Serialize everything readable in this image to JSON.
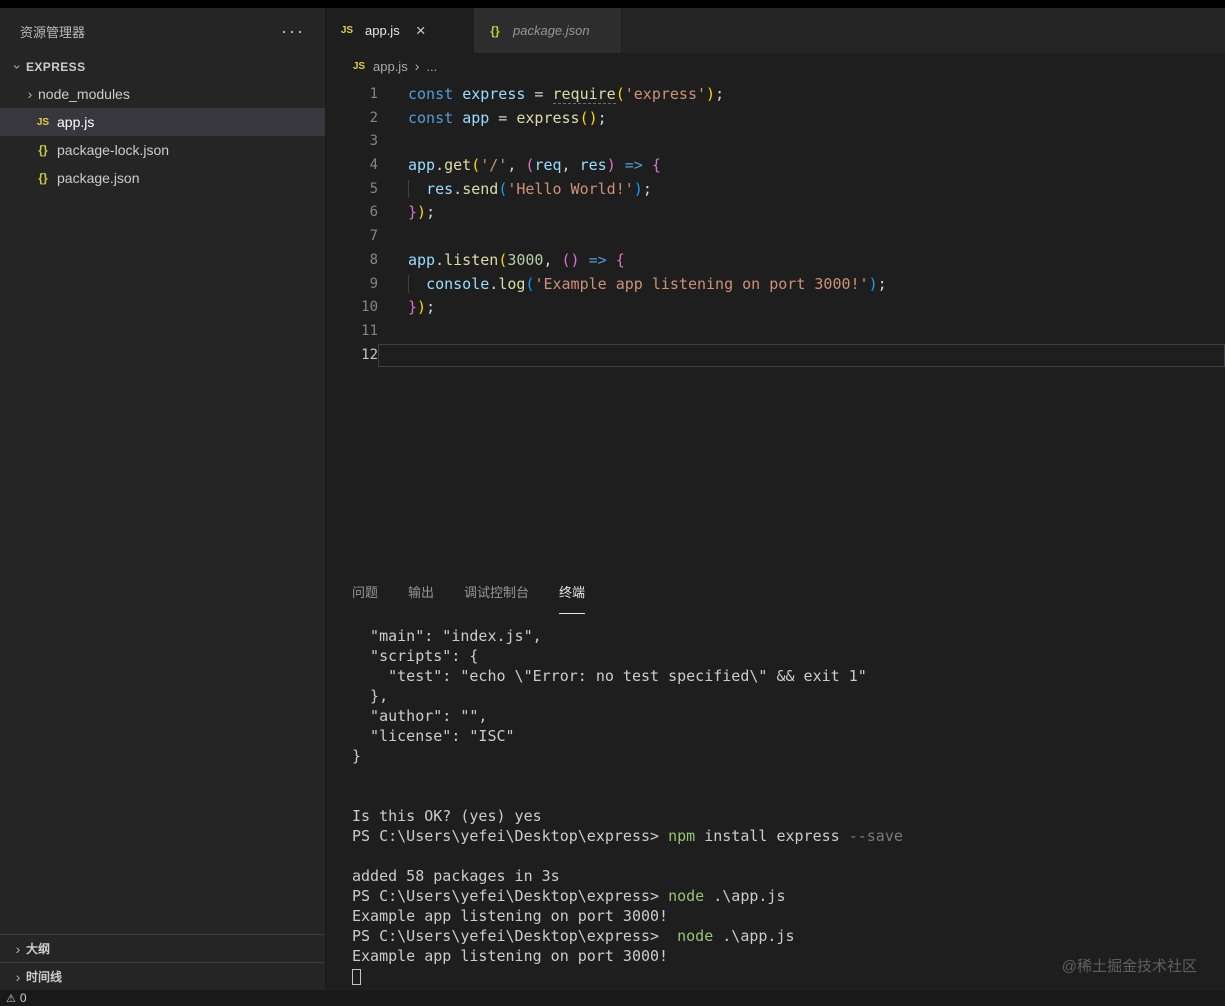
{
  "explorer": {
    "title": "资源管理器",
    "more_label": "···",
    "root": "EXPRESS",
    "items": [
      {
        "label": "node_modules",
        "kind": "folder"
      },
      {
        "label": "app.js",
        "kind": "js",
        "selected": true
      },
      {
        "label": "package-lock.json",
        "kind": "json"
      },
      {
        "label": "package.json",
        "kind": "json"
      }
    ],
    "bottom_sections": [
      {
        "label": "大纲"
      },
      {
        "label": "时间线"
      }
    ]
  },
  "icons": {
    "js": "JS",
    "json": "{}",
    "chevron": "›",
    "close": "×",
    "warning": "⚠"
  },
  "tabs": [
    {
      "label": "app.js",
      "kind": "js",
      "active": true
    },
    {
      "label": "package.json",
      "kind": "json",
      "preview": true
    }
  ],
  "breadcrumb": {
    "file": "app.js",
    "more": "..."
  },
  "editor": {
    "lines": [
      {
        "num": 1,
        "tokens": [
          [
            "kw",
            "const"
          ],
          [
            "pun",
            " "
          ],
          [
            "var",
            "express"
          ],
          [
            "pun",
            " = "
          ],
          [
            "fnu",
            "require"
          ],
          [
            "b1",
            "("
          ],
          [
            "str",
            "'express'"
          ],
          [
            "b1",
            ")"
          ],
          [
            "pun",
            ";"
          ]
        ]
      },
      {
        "num": 2,
        "tokens": [
          [
            "kw",
            "const"
          ],
          [
            "pun",
            " "
          ],
          [
            "var",
            "app"
          ],
          [
            "pun",
            " = "
          ],
          [
            "fn",
            "express"
          ],
          [
            "b1",
            "()"
          ],
          [
            "pun",
            ";"
          ]
        ]
      },
      {
        "num": 3,
        "tokens": []
      },
      {
        "num": 4,
        "tokens": [
          [
            "var",
            "app"
          ],
          [
            "pun",
            "."
          ],
          [
            "fn",
            "get"
          ],
          [
            "b1",
            "("
          ],
          [
            "str",
            "'/'"
          ],
          [
            "pun",
            ", "
          ],
          [
            "b2",
            "("
          ],
          [
            "var",
            "req"
          ],
          [
            "pun",
            ", "
          ],
          [
            "var",
            "res"
          ],
          [
            "b2",
            ")"
          ],
          [
            "pun",
            " "
          ],
          [
            "kw",
            "=>"
          ],
          [
            "pun",
            " "
          ],
          [
            "b2",
            "{"
          ]
        ]
      },
      {
        "num": 5,
        "tokens": [
          [
            "guide",
            ""
          ],
          [
            "pun",
            "  "
          ],
          [
            "var",
            "res"
          ],
          [
            "pun",
            "."
          ],
          [
            "fn",
            "send"
          ],
          [
            "b3",
            "("
          ],
          [
            "str",
            "'Hello World!'"
          ],
          [
            "b3",
            ")"
          ],
          [
            "pun",
            ";"
          ]
        ]
      },
      {
        "num": 6,
        "tokens": [
          [
            "b2",
            "}"
          ],
          [
            "b1",
            ")"
          ],
          [
            "pun",
            ";"
          ]
        ]
      },
      {
        "num": 7,
        "tokens": []
      },
      {
        "num": 8,
        "tokens": [
          [
            "var",
            "app"
          ],
          [
            "pun",
            "."
          ],
          [
            "fn",
            "listen"
          ],
          [
            "b1",
            "("
          ],
          [
            "num",
            "3000"
          ],
          [
            "pun",
            ", "
          ],
          [
            "b2",
            "()"
          ],
          [
            "pun",
            " "
          ],
          [
            "kw",
            "=>"
          ],
          [
            "pun",
            " "
          ],
          [
            "b2",
            "{"
          ]
        ]
      },
      {
        "num": 9,
        "tokens": [
          [
            "guide",
            ""
          ],
          [
            "pun",
            "  "
          ],
          [
            "var",
            "console"
          ],
          [
            "pun",
            "."
          ],
          [
            "fn",
            "log"
          ],
          [
            "b3",
            "("
          ],
          [
            "str",
            "'Example app listening on port 3000!'"
          ],
          [
            "b3",
            ")"
          ],
          [
            "pun",
            ";"
          ]
        ]
      },
      {
        "num": 10,
        "tokens": [
          [
            "b2",
            "}"
          ],
          [
            "b1",
            ")"
          ],
          [
            "pun",
            ";"
          ]
        ]
      },
      {
        "num": 11,
        "tokens": []
      },
      {
        "num": 12,
        "tokens": [],
        "current": true
      }
    ]
  },
  "panel": {
    "tabs": [
      {
        "label": "问题"
      },
      {
        "label": "输出"
      },
      {
        "label": "调试控制台"
      },
      {
        "label": "终端",
        "active": true
      }
    ],
    "terminal_lines": [
      [
        [
          "def",
          "  \"main\": \"index.js\","
        ]
      ],
      [
        [
          "def",
          "  \"scripts\": {"
        ]
      ],
      [
        [
          "def",
          "    \"test\": \"echo \\\"Error: no test specified\\\" && exit 1\""
        ]
      ],
      [
        [
          "def",
          "  },"
        ]
      ],
      [
        [
          "def",
          "  \"author\": \"\","
        ]
      ],
      [
        [
          "def",
          "  \"license\": \"ISC\""
        ]
      ],
      [
        [
          "def",
          "}"
        ]
      ],
      [],
      [],
      [
        [
          "def",
          "Is this OK? (yes) yes"
        ]
      ],
      [
        [
          "def",
          "PS C:\\Users\\yefei\\Desktop\\express> "
        ],
        [
          "cmd",
          "npm"
        ],
        [
          "def",
          " install express "
        ],
        [
          "dim",
          "--save"
        ]
      ],
      [],
      [
        [
          "def",
          "added 58 packages in 3s"
        ]
      ],
      [
        [
          "def",
          "PS C:\\Users\\yefei\\Desktop\\express> "
        ],
        [
          "cmd",
          "node"
        ],
        [
          "def",
          " .\\app.js"
        ]
      ],
      [
        [
          "def",
          "Example app listening on port 3000!"
        ]
      ],
      [
        [
          "def",
          "PS C:\\Users\\yefei\\Desktop\\express>  "
        ],
        [
          "cmd",
          "node"
        ],
        [
          "def",
          " .\\app.js"
        ]
      ],
      [
        [
          "def",
          "Example app listening on port 3000!"
        ]
      ],
      [
        [
          "cursor",
          ""
        ]
      ]
    ]
  },
  "watermark": "@稀土掘金技术社区",
  "status_bar": {
    "problems_count": "0"
  }
}
